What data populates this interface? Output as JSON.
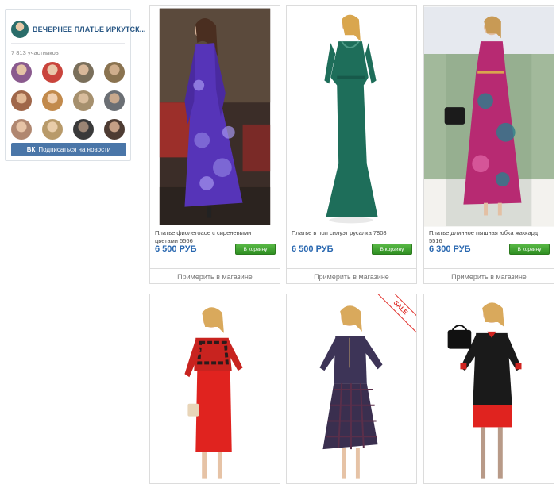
{
  "vk_widget": {
    "group_name": "ВЕЧЕРНЕЕ ПЛАТЬЕ ИРКУТСК...",
    "members_count": "7 813 участников",
    "subscribe_label": "Подписаться на новости",
    "vk_logo": "ВК",
    "member_avatars": [
      "#8a5a8e",
      "#c9443c",
      "#7a6f5b",
      "#8a7350",
      "#a0674a",
      "#c28a4c",
      "#a6906e",
      "#6b6f74",
      "#b08770",
      "#b89a6a",
      "#3a3a3a",
      "#4e3c33"
    ]
  },
  "products": [
    {
      "title": "Платье фиолетоаое с сиреневыми цветами 5566",
      "price": "6 500 РУБ",
      "cart_label": "В корзину",
      "try_label": "Примерить в магазине",
      "image": "purple-floral-dress-photo"
    },
    {
      "title": "Платье в пол силуэт русалка 7808",
      "price": "6 500 РУБ",
      "cart_label": "В корзину",
      "try_label": "Примерить в магазине",
      "image": "green-mermaid-dress-photo"
    },
    {
      "title": "Платье длинное пышная юбка жаккард 5516",
      "price": "6 300 РУБ",
      "cart_label": "В корзину",
      "try_label": "Примерить в магазине",
      "image": "pink-jacquard-dress-photo"
    },
    {
      "image": "red-pencil-dress-photo"
    },
    {
      "image": "plaid-purple-dress-photo",
      "badge": "SALE"
    },
    {
      "image": "black-red-dress-photo"
    }
  ]
}
